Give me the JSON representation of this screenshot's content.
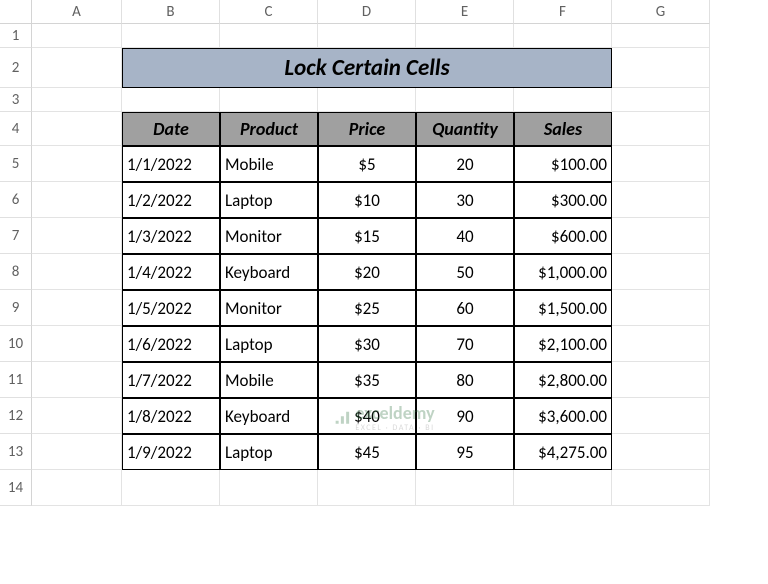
{
  "columns": [
    "A",
    "B",
    "C",
    "D",
    "E",
    "F",
    "G"
  ],
  "rows": [
    "1",
    "2",
    "3",
    "4",
    "5",
    "6",
    "7",
    "8",
    "9",
    "10",
    "11",
    "12",
    "13",
    "14"
  ],
  "title": "Lock Certain Cells",
  "headers": [
    "Date",
    "Product",
    "Price",
    "Quantity",
    "Sales"
  ],
  "data": [
    {
      "date": "1/1/2022",
      "product": "Mobile",
      "price": "$5",
      "quantity": "20",
      "sales": "$100.00"
    },
    {
      "date": "1/2/2022",
      "product": "Laptop",
      "price": "$10",
      "quantity": "30",
      "sales": "$300.00"
    },
    {
      "date": "1/3/2022",
      "product": "Monitor",
      "price": "$15",
      "quantity": "40",
      "sales": "$600.00"
    },
    {
      "date": "1/4/2022",
      "product": "Keyboard",
      "price": "$20",
      "quantity": "50",
      "sales": "$1,000.00"
    },
    {
      "date": "1/5/2022",
      "product": "Monitor",
      "price": "$25",
      "quantity": "60",
      "sales": "$1,500.00"
    },
    {
      "date": "1/6/2022",
      "product": "Laptop",
      "price": "$30",
      "quantity": "70",
      "sales": "$2,100.00"
    },
    {
      "date": "1/7/2022",
      "product": "Mobile",
      "price": "$35",
      "quantity": "80",
      "sales": "$2,800.00"
    },
    {
      "date": "1/8/2022",
      "product": "Keyboard",
      "price": "$40",
      "quantity": "90",
      "sales": "$3,600.00"
    },
    {
      "date": "1/9/2022",
      "product": "Laptop",
      "price": "$45",
      "quantity": "95",
      "sales": "$4,275.00"
    }
  ],
  "watermark": {
    "name": "exceldemy",
    "tagline": "EXCEL · DATA · BI"
  }
}
